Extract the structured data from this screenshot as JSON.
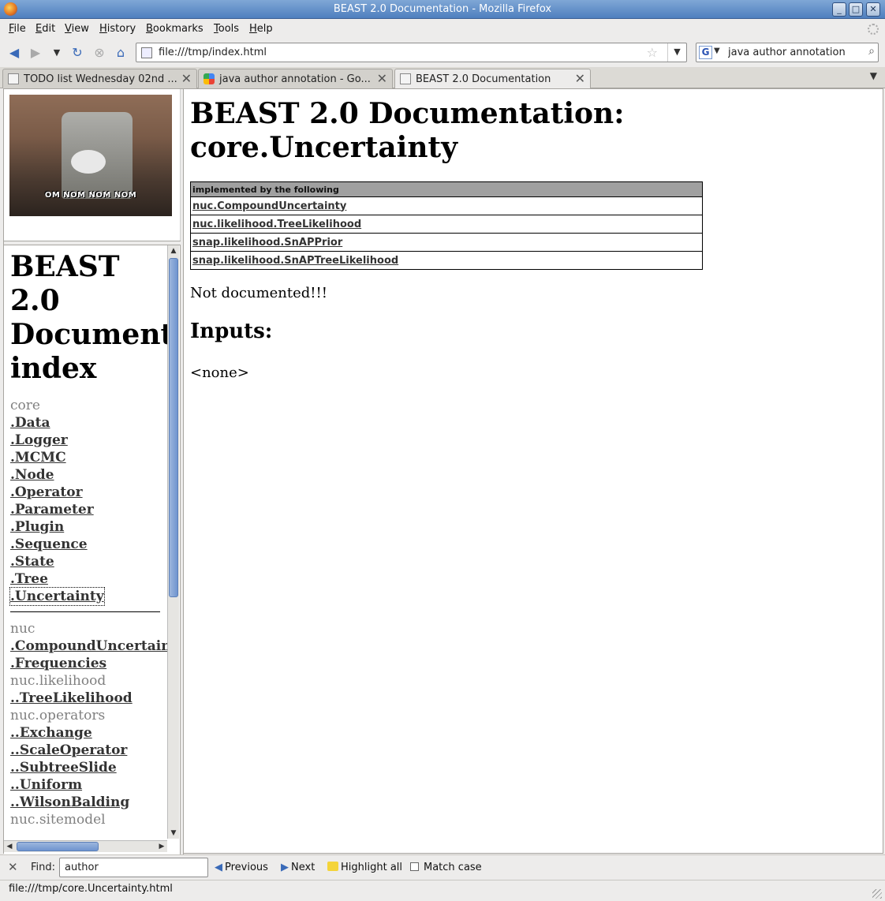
{
  "window": {
    "title": "BEAST 2.0 Documentation - Mozilla Firefox",
    "controls": [
      "minimize",
      "maximize",
      "close"
    ]
  },
  "menu": [
    "File",
    "Edit",
    "View",
    "History",
    "Bookmarks",
    "Tools",
    "Help"
  ],
  "nav": {
    "url": "file:///tmp/index.html",
    "search_value": "java author annotation",
    "search_engine": "G"
  },
  "tabs": [
    {
      "label": "TODO list Wednesday 02nd ...",
      "active": false
    },
    {
      "label": "java author annotation - Go...",
      "active": false
    },
    {
      "label": "BEAST 2.0 Documentation",
      "active": true
    }
  ],
  "sidebar_image": {
    "caption": "OM NOM NOM NOM"
  },
  "index": {
    "title_lines": [
      "BEAST",
      "2.0",
      "Documentation",
      "index"
    ],
    "groups": [
      {
        "package": "core",
        "items": [
          ".Data",
          ".Logger",
          ".MCMC",
          ".Node",
          ".Operator",
          ".Parameter",
          ".Plugin",
          ".Sequence",
          ".State",
          ".Tree",
          ".Uncertainty"
        ],
        "selected": ".Uncertainty"
      },
      {
        "package": "nuc",
        "items": [
          ".CompoundUncertainty",
          ".Frequencies"
        ]
      },
      {
        "package": "nuc.likelihood",
        "items": [
          "..TreeLikelihood"
        ]
      },
      {
        "package": "nuc.operators",
        "items": [
          "..Exchange",
          "..ScaleOperator",
          "..SubtreeSlide",
          "..Uniform",
          "..WilsonBalding"
        ]
      },
      {
        "package": "nuc.sitemodel",
        "items": []
      }
    ]
  },
  "main": {
    "title_line1": "BEAST 2.0 Documentation:",
    "title_line2": "core.Uncertainty",
    "impl_header": "implemented by the following",
    "impl_rows": [
      "nuc.CompoundUncertainty",
      "nuc.likelihood.TreeLikelihood",
      "snap.likelihood.SnAPPrior",
      "snap.likelihood.SnAPTreeLikelihood"
    ],
    "description": "Not documented!!!",
    "inputs_heading": "Inputs:",
    "inputs_value": "<none>"
  },
  "findbar": {
    "label": "Find:",
    "value": "author",
    "previous": "Previous",
    "next": "Next",
    "highlight": "Highlight all",
    "match_case": "Match case"
  },
  "status": {
    "text": "file:///tmp/core.Uncertainty.html"
  }
}
